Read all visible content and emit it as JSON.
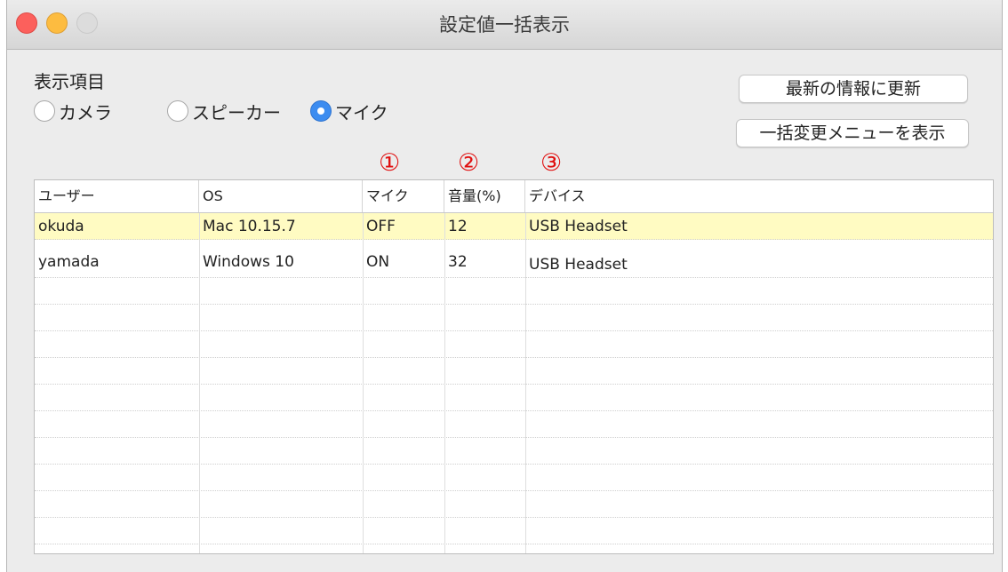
{
  "window": {
    "title": "設定値一括表示"
  },
  "display_items": {
    "label": "表示項目",
    "options": [
      {
        "label": "カメラ",
        "checked": false
      },
      {
        "label": "スピーカー",
        "checked": false
      },
      {
        "label": "マイク",
        "checked": true
      }
    ]
  },
  "buttons": {
    "refresh": "最新の情報に更新",
    "bulk_menu": "一括変更メニューを表示"
  },
  "markers": [
    "①",
    "②",
    "③"
  ],
  "table": {
    "columns": [
      "ユーザー",
      "OS",
      "マイク",
      "音量(%)",
      "デバイス"
    ],
    "rows": [
      [
        "okuda",
        "Mac 10.15.7",
        "OFF",
        "12",
        "USB Headset"
      ],
      [
        "yamada",
        "Windows 10",
        "ON",
        "32",
        "USB Headset"
      ]
    ],
    "selected_row": 0
  },
  "colors": {
    "accent": "#3c8cf0",
    "selected_row": "#fffbc2",
    "marker": "#e01010"
  }
}
